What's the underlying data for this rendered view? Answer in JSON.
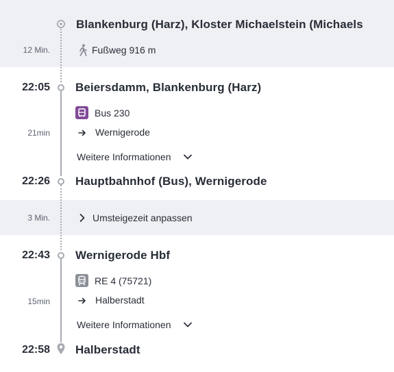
{
  "origin": {
    "name": "Blankenburg (Harz), Kloster Michaelstein (Michaels",
    "walk_duration": "12 Min.",
    "walk_label": "Fußweg 916 m"
  },
  "leg1": {
    "dep_time": "22:05",
    "dep_stop": "Beiersdamm, Blankenburg (Harz)",
    "line": "Bus 230",
    "direction": "Wernigerode",
    "duration": "21min",
    "more_info": "Weitere Informationen",
    "arr_time": "22:26",
    "arr_stop": "Hauptbahnhof (Bus), Wernigerode"
  },
  "transfer": {
    "duration": "3 Min.",
    "label": "Umsteigezeit anpassen"
  },
  "leg2": {
    "dep_time": "22:43",
    "dep_stop": "Wernigerode Hbf",
    "line": "RE 4 (75721)",
    "direction": "Halberstadt",
    "duration": "15min",
    "more_info": "Weitere Informationen",
    "arr_time": "22:58",
    "arr_stop": "Halberstadt"
  },
  "colors": {
    "bus": "#814997",
    "train": "#8b8f97",
    "band": "#eef0f3",
    "line": "#a7abb3"
  },
  "icons": [
    "origin-stop-icon",
    "walk-icon",
    "bus-icon",
    "arrow-right-icon",
    "chevron-down-icon",
    "chevron-right-icon",
    "train-icon",
    "destination-pin-icon"
  ]
}
